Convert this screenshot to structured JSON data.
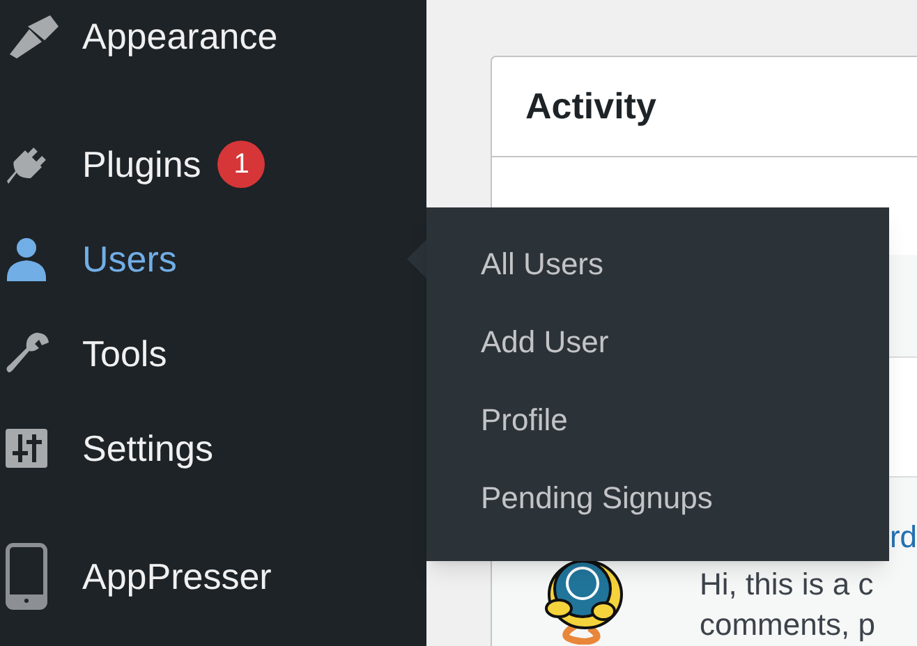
{
  "sidebar": {
    "items": [
      {
        "label": "Appearance",
        "selected": false
      },
      {
        "label": "Plugins",
        "selected": false,
        "badge": "1"
      },
      {
        "label": "Users",
        "selected": true
      },
      {
        "label": "Tools",
        "selected": false
      },
      {
        "label": "Settings",
        "selected": false
      },
      {
        "label": "AppPresser",
        "selected": false
      }
    ]
  },
  "flyout_menu": {
    "items": [
      {
        "label": "All Users"
      },
      {
        "label": "Add User"
      },
      {
        "label": "Profile"
      },
      {
        "label": "Pending Signups"
      }
    ]
  },
  "activity_card": {
    "title": "Activity",
    "comment": {
      "author_link": "rd",
      "text_lines": [
        "Hi, this is a c",
        "comments, p"
      ]
    }
  }
}
